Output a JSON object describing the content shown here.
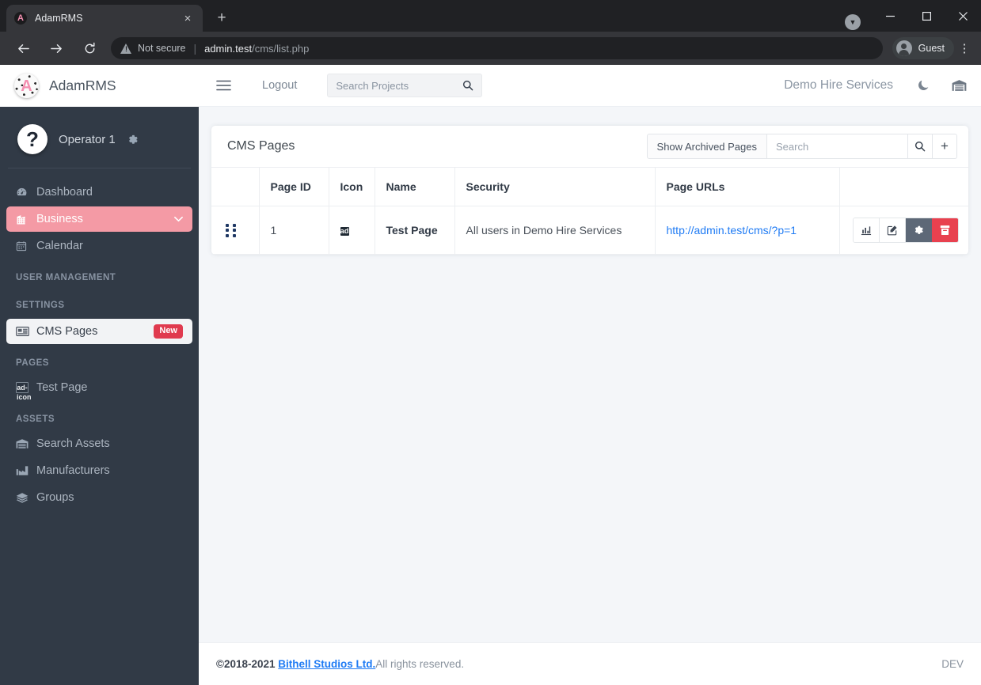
{
  "browser": {
    "tab": {
      "title": "AdamRMS",
      "favicon_letter": "A",
      "close_label": "×"
    },
    "new_tab_label": "+",
    "window_controls": {
      "minimize": "—",
      "maximize": "☐",
      "close": "×"
    },
    "download_icon": "download-chip",
    "nav": {
      "back": "←",
      "forward": "→",
      "reload": "⟳"
    },
    "omnibox": {
      "security_label": "Not secure",
      "url_host": "admin.test",
      "url_path": "/cms/list.php"
    },
    "profile_label": "Guest",
    "menu_label": "⋮"
  },
  "sidebar": {
    "brand": {
      "name": "AdamRMS",
      "logo_letter": "A"
    },
    "user": {
      "name": "Operator 1",
      "avatar_glyph": "?",
      "settings_icon": "gear-icon"
    },
    "nav_items": [
      {
        "label": "Dashboard",
        "icon": "dashboard-icon",
        "state": "normal"
      },
      {
        "label": "Business",
        "icon": "building-icon",
        "state": "active-pink",
        "chevron": "⌄"
      },
      {
        "label": "Calendar",
        "icon": "calendar-icon",
        "state": "normal"
      }
    ],
    "section_user_management": "USER MANAGEMENT",
    "section_settings": "SETTINGS",
    "cms_pages": {
      "label": "CMS Pages",
      "badge": "New",
      "icon": "news-icon"
    },
    "section_pages": "PAGES",
    "page_items": [
      {
        "label": "Test Page",
        "icon": "ad-icon"
      }
    ],
    "section_assets": "ASSETS",
    "asset_items": [
      {
        "label": "Search Assets",
        "icon": "warehouse-icon"
      },
      {
        "label": "Manufacturers",
        "icon": "industry-icon"
      },
      {
        "label": "Groups",
        "icon": "layers-icon"
      }
    ]
  },
  "topnav": {
    "menu_icon": "hamburger-icon",
    "logout_label": "Logout",
    "search_placeholder": "Search Projects",
    "search_value": "",
    "search_icon": "search-icon",
    "business_name": "Demo Hire Services",
    "dark_mode_icon": "moon-icon",
    "warehouse_icon": "warehouse-icon"
  },
  "card": {
    "title": "CMS Pages",
    "show_archived_label": "Show Archived Pages",
    "search_placeholder": "Search",
    "search_value": "",
    "search_icon": "search-icon",
    "add_label": "+"
  },
  "table": {
    "columns": [
      "",
      "Page ID",
      "Icon",
      "Name",
      "Security",
      "Page URLs",
      ""
    ],
    "rows": [
      {
        "grip": "drag-handle",
        "page_id": "1",
        "icon": "ad",
        "name": "Test Page",
        "security": "All users in Demo Hire Services",
        "url": "http://admin.test/cms/?p=1",
        "actions": [
          "stats-icon",
          "edit-icon",
          "gear-icon",
          "archive-icon"
        ]
      }
    ]
  },
  "footer": {
    "copyright": "©2018-2021",
    "company": "Bithell Studios Ltd.",
    "rights": " All rights reserved.",
    "env": "DEV"
  },
  "colors": {
    "sidebar_bg": "#313a46",
    "accent_pink": "#f49aa5",
    "badge_red": "#e03a4e",
    "link_blue": "#1f7bf4",
    "archive_red": "#e8414f",
    "gear_gray": "#5d6877"
  }
}
